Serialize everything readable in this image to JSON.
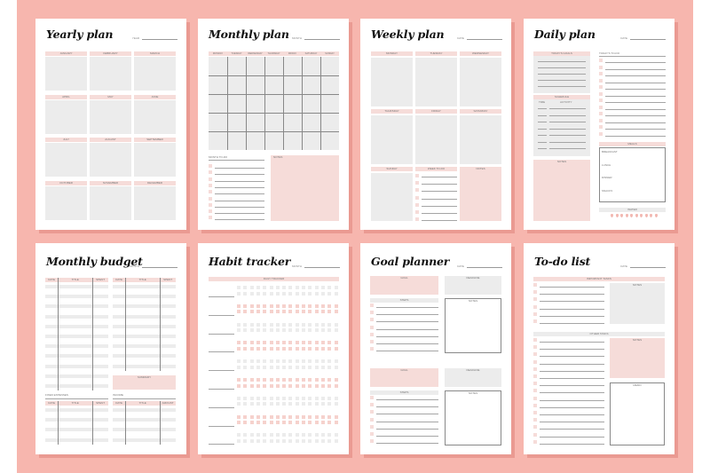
{
  "colors": {
    "background": "#f7b6ae",
    "accent_pink": "#f6dcd9",
    "panel_gray": "#ececec",
    "shadow": "#ea9a92"
  },
  "pages": {
    "yearly": {
      "title": "Yearly plan",
      "header_label": "Year",
      "months": [
        "January",
        "February",
        "March",
        "April",
        "May",
        "June",
        "July",
        "August",
        "September",
        "October",
        "November",
        "December"
      ]
    },
    "monthly": {
      "title": "Monthly plan",
      "header_label": "Month",
      "weekdays": [
        "Monday",
        "Tuesday",
        "Wednesday",
        "Thursday",
        "Friday",
        "Saturday",
        "Sunday"
      ],
      "todo_label": "Month to-do",
      "notes_label": "Notes"
    },
    "weekly": {
      "title": "Weekly plan",
      "header_label": "Date",
      "days": [
        "Monday",
        "Tuesday",
        "Wednesday",
        "Thursday",
        "Friday",
        "Saturday",
        "Sunday"
      ],
      "todo_label": "Week to-do",
      "notes_label": "Notes"
    },
    "daily": {
      "title": "Daily plan",
      "header_label": "Date",
      "goals_label": "Today's goals",
      "todo_label": "Today's to-do",
      "schedule_label": "Schedule",
      "time_label": "Time",
      "activity_label": "Activity",
      "notes_label": "Notes",
      "meals_label": "Meals",
      "meals": [
        "Breakfast",
        "Lunch",
        "Dinner",
        "Snacks"
      ],
      "water_label": "Water",
      "water_drops": 10
    },
    "budget": {
      "title": "Monthly budget",
      "header_label": "Month",
      "columns": [
        "Date",
        "Title",
        "Spent"
      ],
      "summary_label": "Summary",
      "fixed_label": "Fixed expenses",
      "income_label": "Income",
      "income_columns": [
        "Date",
        "Title",
        "Amount"
      ]
    },
    "habit": {
      "title": "Habit tracker",
      "header_label": "Month",
      "tracker_label": "Daily tracker",
      "habits": 9,
      "days_per_row": 16
    },
    "goal": {
      "title": "Goal planner",
      "header_label": "Date",
      "goal_label": "Goal",
      "deadline_label": "Deadline",
      "steps_label": "Steps",
      "notes_label": "Notes"
    },
    "todo": {
      "title": "To-do list",
      "header_label": "Date",
      "important_label": "Important tasks",
      "other_label": "Other tasks",
      "notes_label": "Notes",
      "memo_label": "Memo"
    }
  }
}
